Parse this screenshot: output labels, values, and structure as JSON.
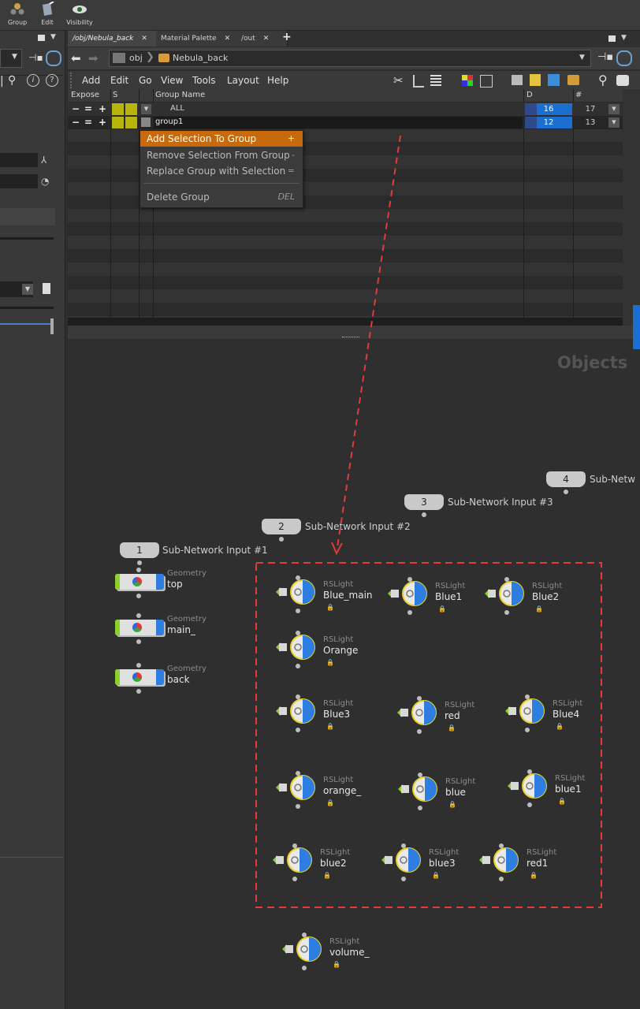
{
  "toolbar": {
    "group": "Group",
    "edit": "Edit",
    "visibility": "Visibility"
  },
  "tabs": [
    {
      "label": "/obj/Nebula_back"
    },
    {
      "label": "Material Palette"
    },
    {
      "label": "/out"
    }
  ],
  "tab_close": "✕",
  "tab_add": "+",
  "path": {
    "root": "obj",
    "current": "Nebula_back"
  },
  "menu": [
    "Add",
    "Edit",
    "Go",
    "View",
    "Tools",
    "Layout",
    "Help"
  ],
  "table": {
    "headers": {
      "expose": "Expose",
      "s": "S",
      "group_name": "Group Name",
      "d": "D",
      "count": "#"
    },
    "ctrl_minus": "−",
    "ctrl_eq": "=",
    "ctrl_plus": "+",
    "rows": [
      {
        "name": "ALL",
        "d": "16",
        "count": "17"
      },
      {
        "name": "group1",
        "d": "12",
        "count": "13"
      }
    ]
  },
  "context_menu": [
    {
      "label": "Add Selection To Group",
      "shortcut": "+",
      "highlighted": true
    },
    {
      "label": "Remove Selection From Group",
      "shortcut": "-"
    },
    {
      "label": "Replace Group with Selection",
      "shortcut": "="
    },
    {
      "label": "Delete Group",
      "shortcut": "DEL"
    }
  ],
  "network": {
    "context_label": "Objects",
    "subnet_inputs": [
      {
        "num": "1",
        "label": "Sub-Network Input #1"
      },
      {
        "num": "2",
        "label": "Sub-Network Input #2"
      },
      {
        "num": "3",
        "label": "Sub-Network Input #3"
      },
      {
        "num": "4",
        "label": "Sub-Netw"
      }
    ],
    "geometry_nodes": [
      {
        "type": "Geometry",
        "name": "top"
      },
      {
        "type": "Geometry",
        "name": "main_"
      },
      {
        "type": "Geometry",
        "name": "back"
      }
    ],
    "lights": [
      {
        "type": "RSLight",
        "name": "Blue_main"
      },
      {
        "type": "RSLight",
        "name": "Blue1"
      },
      {
        "type": "RSLight",
        "name": "Blue2"
      },
      {
        "type": "RSLight",
        "name": "Orange"
      },
      {
        "type": "RSLight",
        "name": "Blue3"
      },
      {
        "type": "RSLight",
        "name": "red"
      },
      {
        "type": "RSLight",
        "name": "Blue4"
      },
      {
        "type": "RSLight",
        "name": "orange_"
      },
      {
        "type": "RSLight",
        "name": "blue"
      },
      {
        "type": "RSLight",
        "name": "blue1"
      },
      {
        "type": "RSLight",
        "name": "blue2"
      },
      {
        "type": "RSLight",
        "name": "blue3"
      },
      {
        "type": "RSLight",
        "name": "red1"
      },
      {
        "type": "RSLight",
        "name": "volume_"
      }
    ]
  },
  "colors": {
    "accent_orange": "#c66a0d",
    "accent_blue": "#1a6fd0",
    "selection_red": "#e33b3b",
    "node_green": "#8cd02a"
  }
}
